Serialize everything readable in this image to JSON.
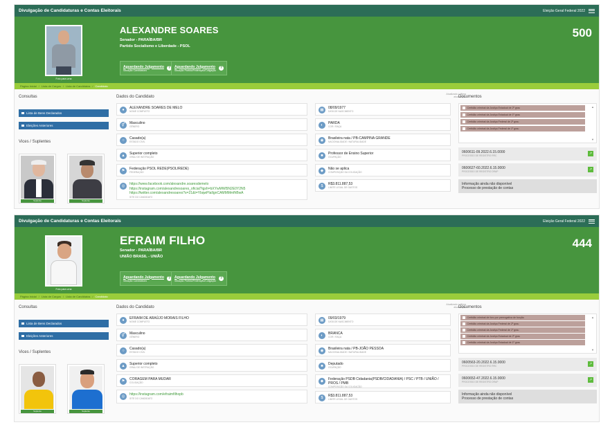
{
  "app_title": "Divulgação de Candidaturas e Contas Eleitorais",
  "photo_caption": "Foto para urna",
  "section_labels": {
    "consultas": "Consultas",
    "dados": "Dados do Candidato",
    "documentos": "Documentos",
    "vices": "Vices / Suplentes",
    "updated": "Atualizado / última atualização"
  },
  "consultas_buttons": [
    "Lista de Bens Declarados",
    "Eleições Anteriores"
  ],
  "status_buttons": [
    {
      "title": "Aguardando Julgamento",
      "subtitle": "Situação Candidatura"
    },
    {
      "title": "Aguardando Julgamento",
      "subtitle": "Situação Partido/Federação/Coligação"
    }
  ],
  "candidates": [
    {
      "election": "Eleição Geral Federal 2022",
      "name": "ALEXANDRE SOARES",
      "office": "Senador - PARAÍBA/BR",
      "party": "Partido Socialismo e Liberdade - PSOL",
      "number": "500",
      "breadcrumb": [
        "Página Inicial",
        "Lista de Cargos",
        "Lista de Candidatos",
        "Candidato"
      ],
      "fields_left": [
        {
          "value": "ALEXANDRE SOARES DE MELO",
          "label": "Nome completo",
          "icon": "person-icon"
        },
        {
          "value": "Masculino",
          "label": "Gênero",
          "icon": "gender-icon"
        },
        {
          "value": "Casado(a)",
          "label": "Estado civil",
          "icon": "ring-icon"
        },
        {
          "value": "Superior completo",
          "label": "Grau de instrução",
          "icon": "graduation-icon"
        },
        {
          "value": "Federação PSOL REDE(PSOL/REDE)",
          "label": "Federação",
          "icon": "flag-icon"
        }
      ],
      "links": [
        "https://www.facebook.com/alexandre.soaresdemelo",
        "https://instagram.com/alexandresoares_oficial?igsh=bXYwMWl5N2E0Y2N5",
        "https://twitter.com/alexandresoares?s=21&t=YbqwPlaIlgnCAMMMmfhBwA"
      ],
      "links_label": "Site do candidato",
      "fields_right": [
        {
          "value": "08/09/1977",
          "label": "Data de nascimento",
          "icon": "calendar-icon"
        },
        {
          "value": "PARDA",
          "label": "Cor / Raça",
          "icon": "palette-icon"
        },
        {
          "value": "Brasileira nata / PB-CAMPINA GRANDE",
          "label": "Nacionalidade / Naturalidade",
          "icon": "globe-icon"
        },
        {
          "value": "Professor de Ensino Superior",
          "label": "Ocupação",
          "icon": "briefcase-icon"
        },
        {
          "value": "Não se aplica",
          "label": "Composição da coligação",
          "icon": "group-icon"
        },
        {
          "value": "R$3.811.887,53",
          "label": "Limite legal de gastos",
          "icon": "money-icon"
        }
      ],
      "documents": [
        "Certidão criminal da Justiça Estadual de 2º grau",
        "Certidão criminal da Justiça Estadual de 1º grau",
        "Certidão criminal da Justiça Federal de 2º grau",
        "Certidão criminal da Justiça Federal de 1º grau"
      ],
      "processes": [
        {
          "number": "0600611-09.2022.6.15.0000",
          "label": "Processo de registro RRC"
        },
        {
          "number": "0600627-60.2022.6.15.0000",
          "label": "Processo de registro DRAP"
        }
      ],
      "info": {
        "value": "Informação ainda não disponível",
        "label": "Processo de prestação de contas"
      },
      "vices": [
        "Suplente",
        "Suplente"
      ]
    },
    {
      "election": "Eleição Geral Federal 2022",
      "name": "EFRAIM FILHO",
      "office": "Senador - PARAÍBA/BR",
      "party": "UNIÃO BRASIL - UNIÃO",
      "number": "444",
      "breadcrumb": [
        "Página Inicial",
        "Lista de Cargos",
        "Lista de Candidatos",
        "Candidato"
      ],
      "fields_left": [
        {
          "value": "EFRAIM DE ARAÚJO MORAIS FILHO",
          "label": "Nome completo",
          "icon": "person-icon"
        },
        {
          "value": "Masculino",
          "label": "Gênero",
          "icon": "gender-icon"
        },
        {
          "value": "Casado(a)",
          "label": "Estado civil",
          "icon": "ring-icon"
        },
        {
          "value": "Superior completo",
          "label": "Grau de instrução",
          "icon": "graduation-icon"
        },
        {
          "value": "CORAGEM PARA MUDAR",
          "label": "Coligação",
          "icon": "flag-icon"
        }
      ],
      "links": [
        "https://instagram.com/efraimfilhopb"
      ],
      "links_label": "Site do candidato",
      "fields_right": [
        {
          "value": "09/03/1979",
          "label": "Data de nascimento",
          "icon": "calendar-icon"
        },
        {
          "value": "BRANCA",
          "label": "Cor / Raça",
          "icon": "palette-icon"
        },
        {
          "value": "Brasileira nata / PB-JOÃO PESSOA",
          "label": "Nacionalidade / Naturalidade",
          "icon": "globe-icon"
        },
        {
          "value": "Deputado",
          "label": "Ocupação",
          "icon": "briefcase-icon"
        },
        {
          "value": "Federação PSDB Cidadania(PSDB/CIDADANIA) / PSC / PTB / UNIÃO / PROS / PMB",
          "label": "Composição da coligação",
          "icon": "group-icon"
        },
        {
          "value": "R$3.811.887,53",
          "label": "Limite legal de gastos",
          "icon": "money-icon"
        }
      ],
      "documents": [
        "Certidão criminal de foro por prerrogativa de função",
        "Certidão criminal da Justiça Federal de 2º grau",
        "Certidão criminal da Justiça Federal de 1º grau",
        "Certidão criminal da Justiça Estadual de 2º grau",
        "Certidão criminal da Justiça Estadual de 1º grau"
      ],
      "processes": [
        {
          "number": "0600563-20.2022.6.15.0000",
          "label": "Processo de registro RRC"
        },
        {
          "number": "0600652-47.2022.6.15.0000",
          "label": "Processo de registro DRAP"
        }
      ],
      "info": {
        "value": "Informação ainda não disponível",
        "label": "Processo de prestação de contas"
      },
      "vices": [
        "Suplente",
        "Suplente"
      ]
    }
  ],
  "colors": {
    "header": "#2c6d57",
    "hero": "#47953e",
    "breadcrumb": "#9acd3b",
    "button": "#2f6ea5",
    "document": "#bca09b"
  }
}
